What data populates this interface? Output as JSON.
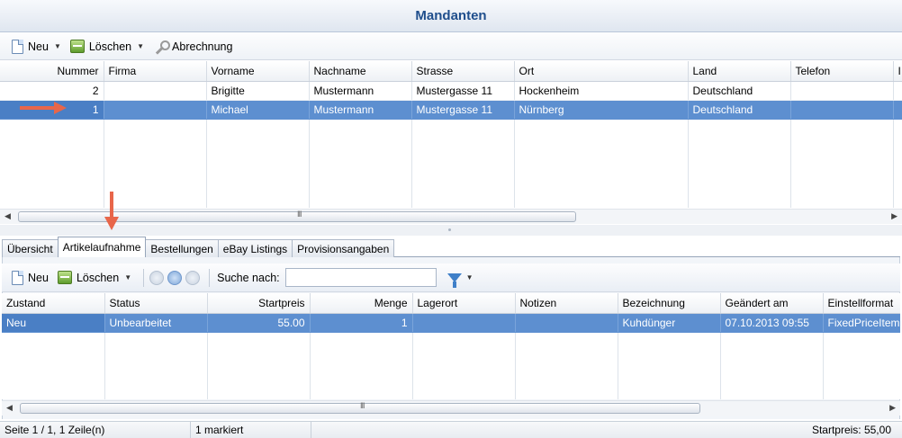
{
  "title": "Mandanten",
  "top_toolbar": {
    "new_label": "Neu",
    "delete_label": "Löschen",
    "billing_label": "Abrechnung"
  },
  "top_grid": {
    "columns": [
      "Nummer",
      "Firma",
      "Vorname",
      "Nachname",
      "Strasse",
      "Ort",
      "Land",
      "Telefon",
      "I"
    ],
    "rows": [
      [
        "2",
        "",
        "Brigitte",
        "Mustermann",
        "Mustergasse 11",
        "Hockenheim",
        "Deutschland",
        "",
        ""
      ],
      [
        "1",
        "",
        "Michael",
        "Mustermann",
        "Mustergasse 11",
        "Nürnberg",
        "Deutschland",
        "",
        ""
      ]
    ],
    "selected_row": 1
  },
  "tabs": [
    "Übersicht",
    "Artikelaufnahme",
    "Bestellungen",
    "eBay Listings",
    "Provisionsangaben"
  ],
  "active_tab": "Artikelaufnahme",
  "sub_toolbar": {
    "new_label": "Neu",
    "delete_label": "Löschen",
    "search_label": "Suche nach:",
    "search_value": ""
  },
  "sub_grid": {
    "columns": [
      "Zustand",
      "Status",
      "Startpreis",
      "Menge",
      "Lagerort",
      "Notizen",
      "Bezeichnung",
      "Geändert am",
      "Einstellformat"
    ],
    "rows": [
      [
        "Neu",
        "Unbearbeitet",
        "55.00",
        "1",
        "",
        "",
        "Kuhdünger",
        "07.10.2013 09:55",
        "FixedPriceItem"
      ]
    ],
    "selected_row": 0
  },
  "scrollbar_glyph": "III",
  "status": {
    "page": "Seite 1 / 1, 1 Zeile(n)",
    "marked": "1 markiert",
    "price": "Startpreis: 55,00"
  },
  "colors": {
    "selection": "#5d8fd0",
    "title_text": "#1f4e8c",
    "annotation_arrow": "#e8664a"
  }
}
